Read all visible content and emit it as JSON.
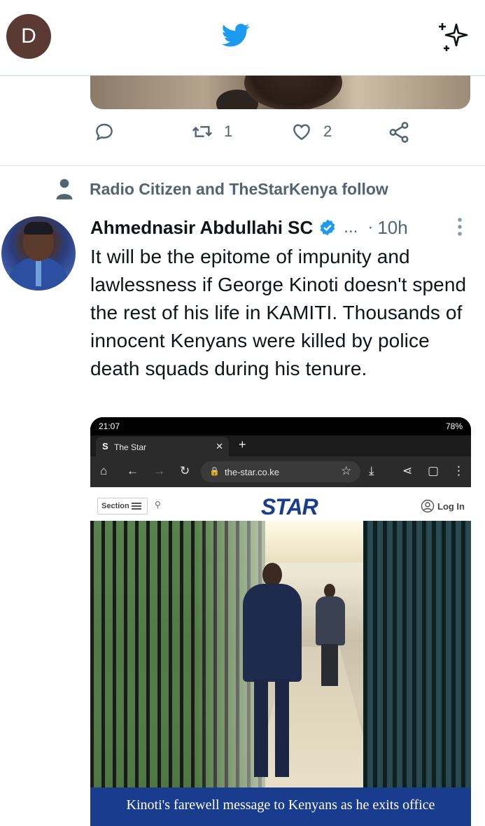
{
  "header": {
    "profile_initial": "D"
  },
  "previous_tweet": {
    "actions": {
      "retweet_count": "1",
      "like_count": "2"
    }
  },
  "tweet": {
    "social_context": "Radio Citizen and TheStarKenya follow",
    "author_name": "Ahmednasir Abdullahi SC",
    "handle_truncated": "...",
    "separator": "·",
    "time": "10h",
    "text": "It will be the epitome of impunity and lawlessness if George Kinoti doesn't spend the rest of his life in KAMITI. Thousands of innocent Kenyans were killed by police death squads during his tenure.",
    "media": {
      "status_time": "21:07",
      "battery": "78%",
      "tab_title": "The Star",
      "tab_favicon": "S",
      "url": "the-star.co.ke",
      "section_label": "Section",
      "site_logo": "STAR",
      "login_label": "Log In",
      "caption": "Kinoti's farewell message to Kenyans as he exits office"
    }
  },
  "colors": {
    "twitter_blue": "#1d9bf0",
    "secondary_text": "#536471",
    "star_blue": "#1a3c8f"
  }
}
